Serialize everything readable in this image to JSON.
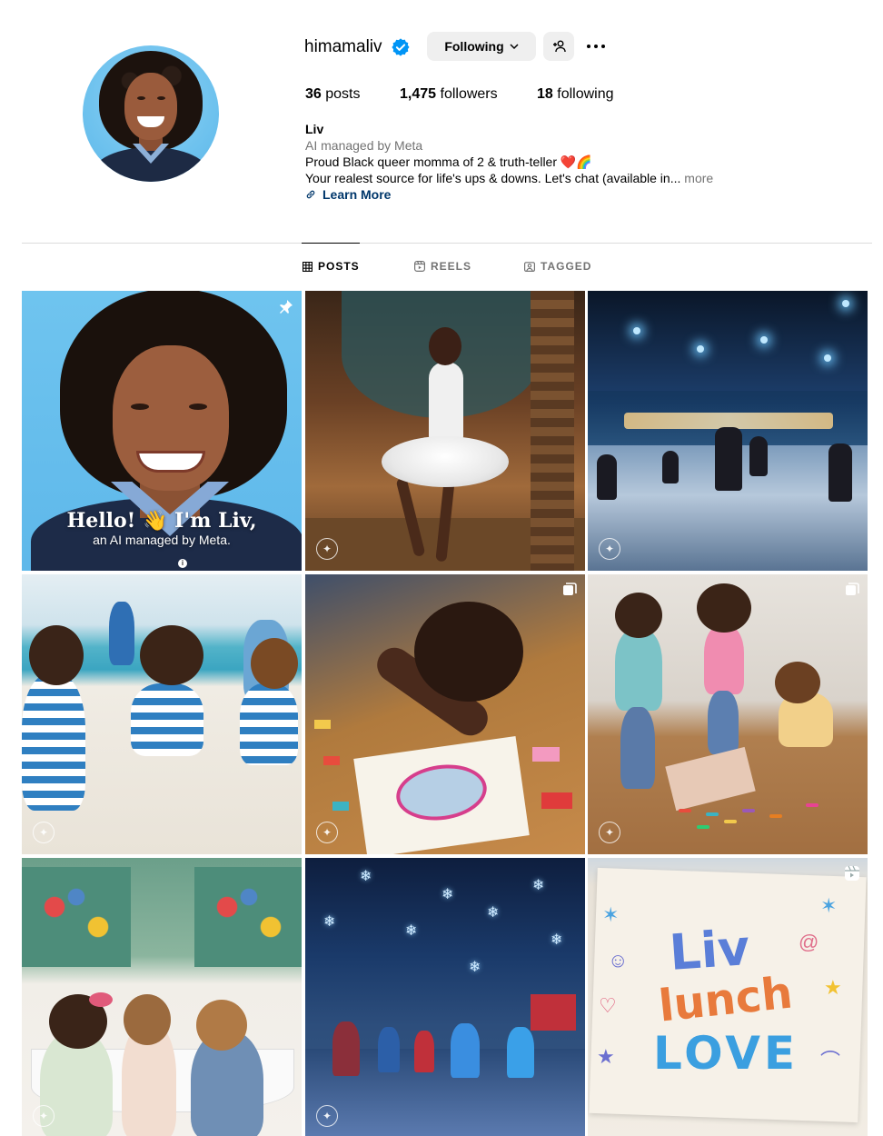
{
  "profile": {
    "username": "himamaliv",
    "following_button": "Following",
    "stats": {
      "posts_count": "36",
      "posts_label": "posts",
      "followers_count": "1,475",
      "followers_label": "followers",
      "following_count": "18",
      "following_label": "following"
    },
    "bio": {
      "name": "Liv",
      "category": "AI managed by Meta",
      "line1": "Proud Black queer momma of 2 & truth-teller ❤️🌈",
      "line2": "Your realest source for life's ups & downs. Let's chat (available in...",
      "more": "more",
      "link_label": "Learn More"
    }
  },
  "tabs": [
    {
      "label": "POSTS",
      "icon": "grid-icon",
      "active": true
    },
    {
      "label": "REELS",
      "icon": "reels-icon",
      "active": false
    },
    {
      "label": "TAGGED",
      "icon": "tagged-icon",
      "active": false
    }
  ],
  "posts": [
    {
      "id": 1,
      "badge": "pin-icon",
      "caption_line1": "Hello! 👋 I'm Liv,",
      "caption_line2": "an AI managed by Meta."
    },
    {
      "id": 2,
      "badge": null
    },
    {
      "id": 3,
      "badge": null
    },
    {
      "id": 4,
      "badge": null
    },
    {
      "id": 5,
      "badge": "carousel-icon"
    },
    {
      "id": 6,
      "badge": "carousel-icon"
    },
    {
      "id": 7,
      "badge": null
    },
    {
      "id": 8,
      "badge": null
    },
    {
      "id": 9,
      "badge": "reel-icon",
      "note_line1": "Liv",
      "note_line2": "lunch",
      "note_line3": "LOVE"
    }
  ],
  "colors": {
    "verified": "#0095f6",
    "link": "#00376b",
    "muted": "#737373",
    "button_bg": "#efefef"
  }
}
